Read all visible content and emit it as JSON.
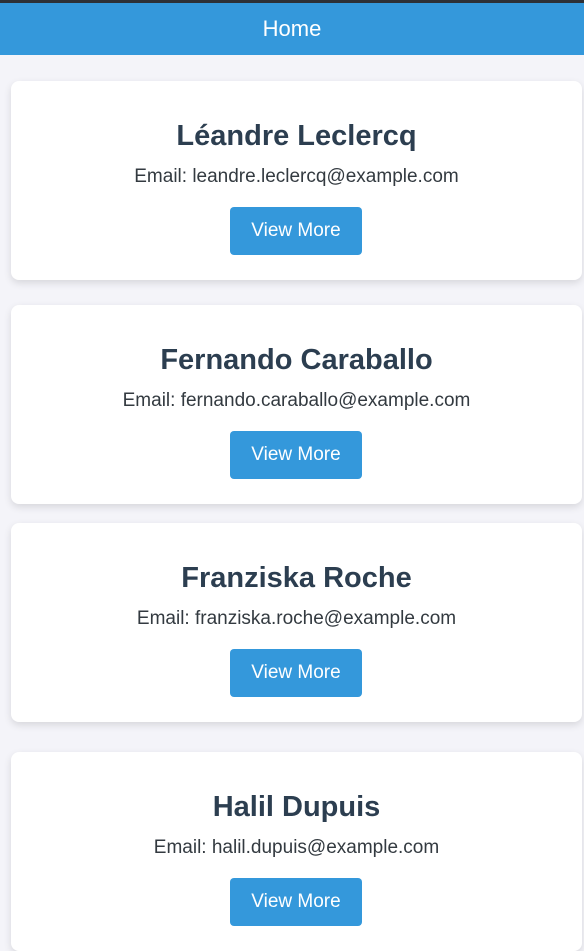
{
  "header": {
    "title": "Home"
  },
  "cards": [
    {
      "name": "Léandre Leclercq",
      "email": "Email: leandre.leclercq@example.com",
      "button": "View More"
    },
    {
      "name": "Fernando Caraballo",
      "email": "Email: fernando.caraballo@example.com",
      "button": "View More"
    },
    {
      "name": "Franziska Roche",
      "email": "Email: franziska.roche@example.com",
      "button": "View More"
    },
    {
      "name": "Halil Dupuis",
      "email": "Email: halil.dupuis@example.com",
      "button": "View More"
    }
  ],
  "colors": {
    "accent": "#3498db",
    "name_text": "#2c3e50",
    "background": "#f4f4f9"
  }
}
